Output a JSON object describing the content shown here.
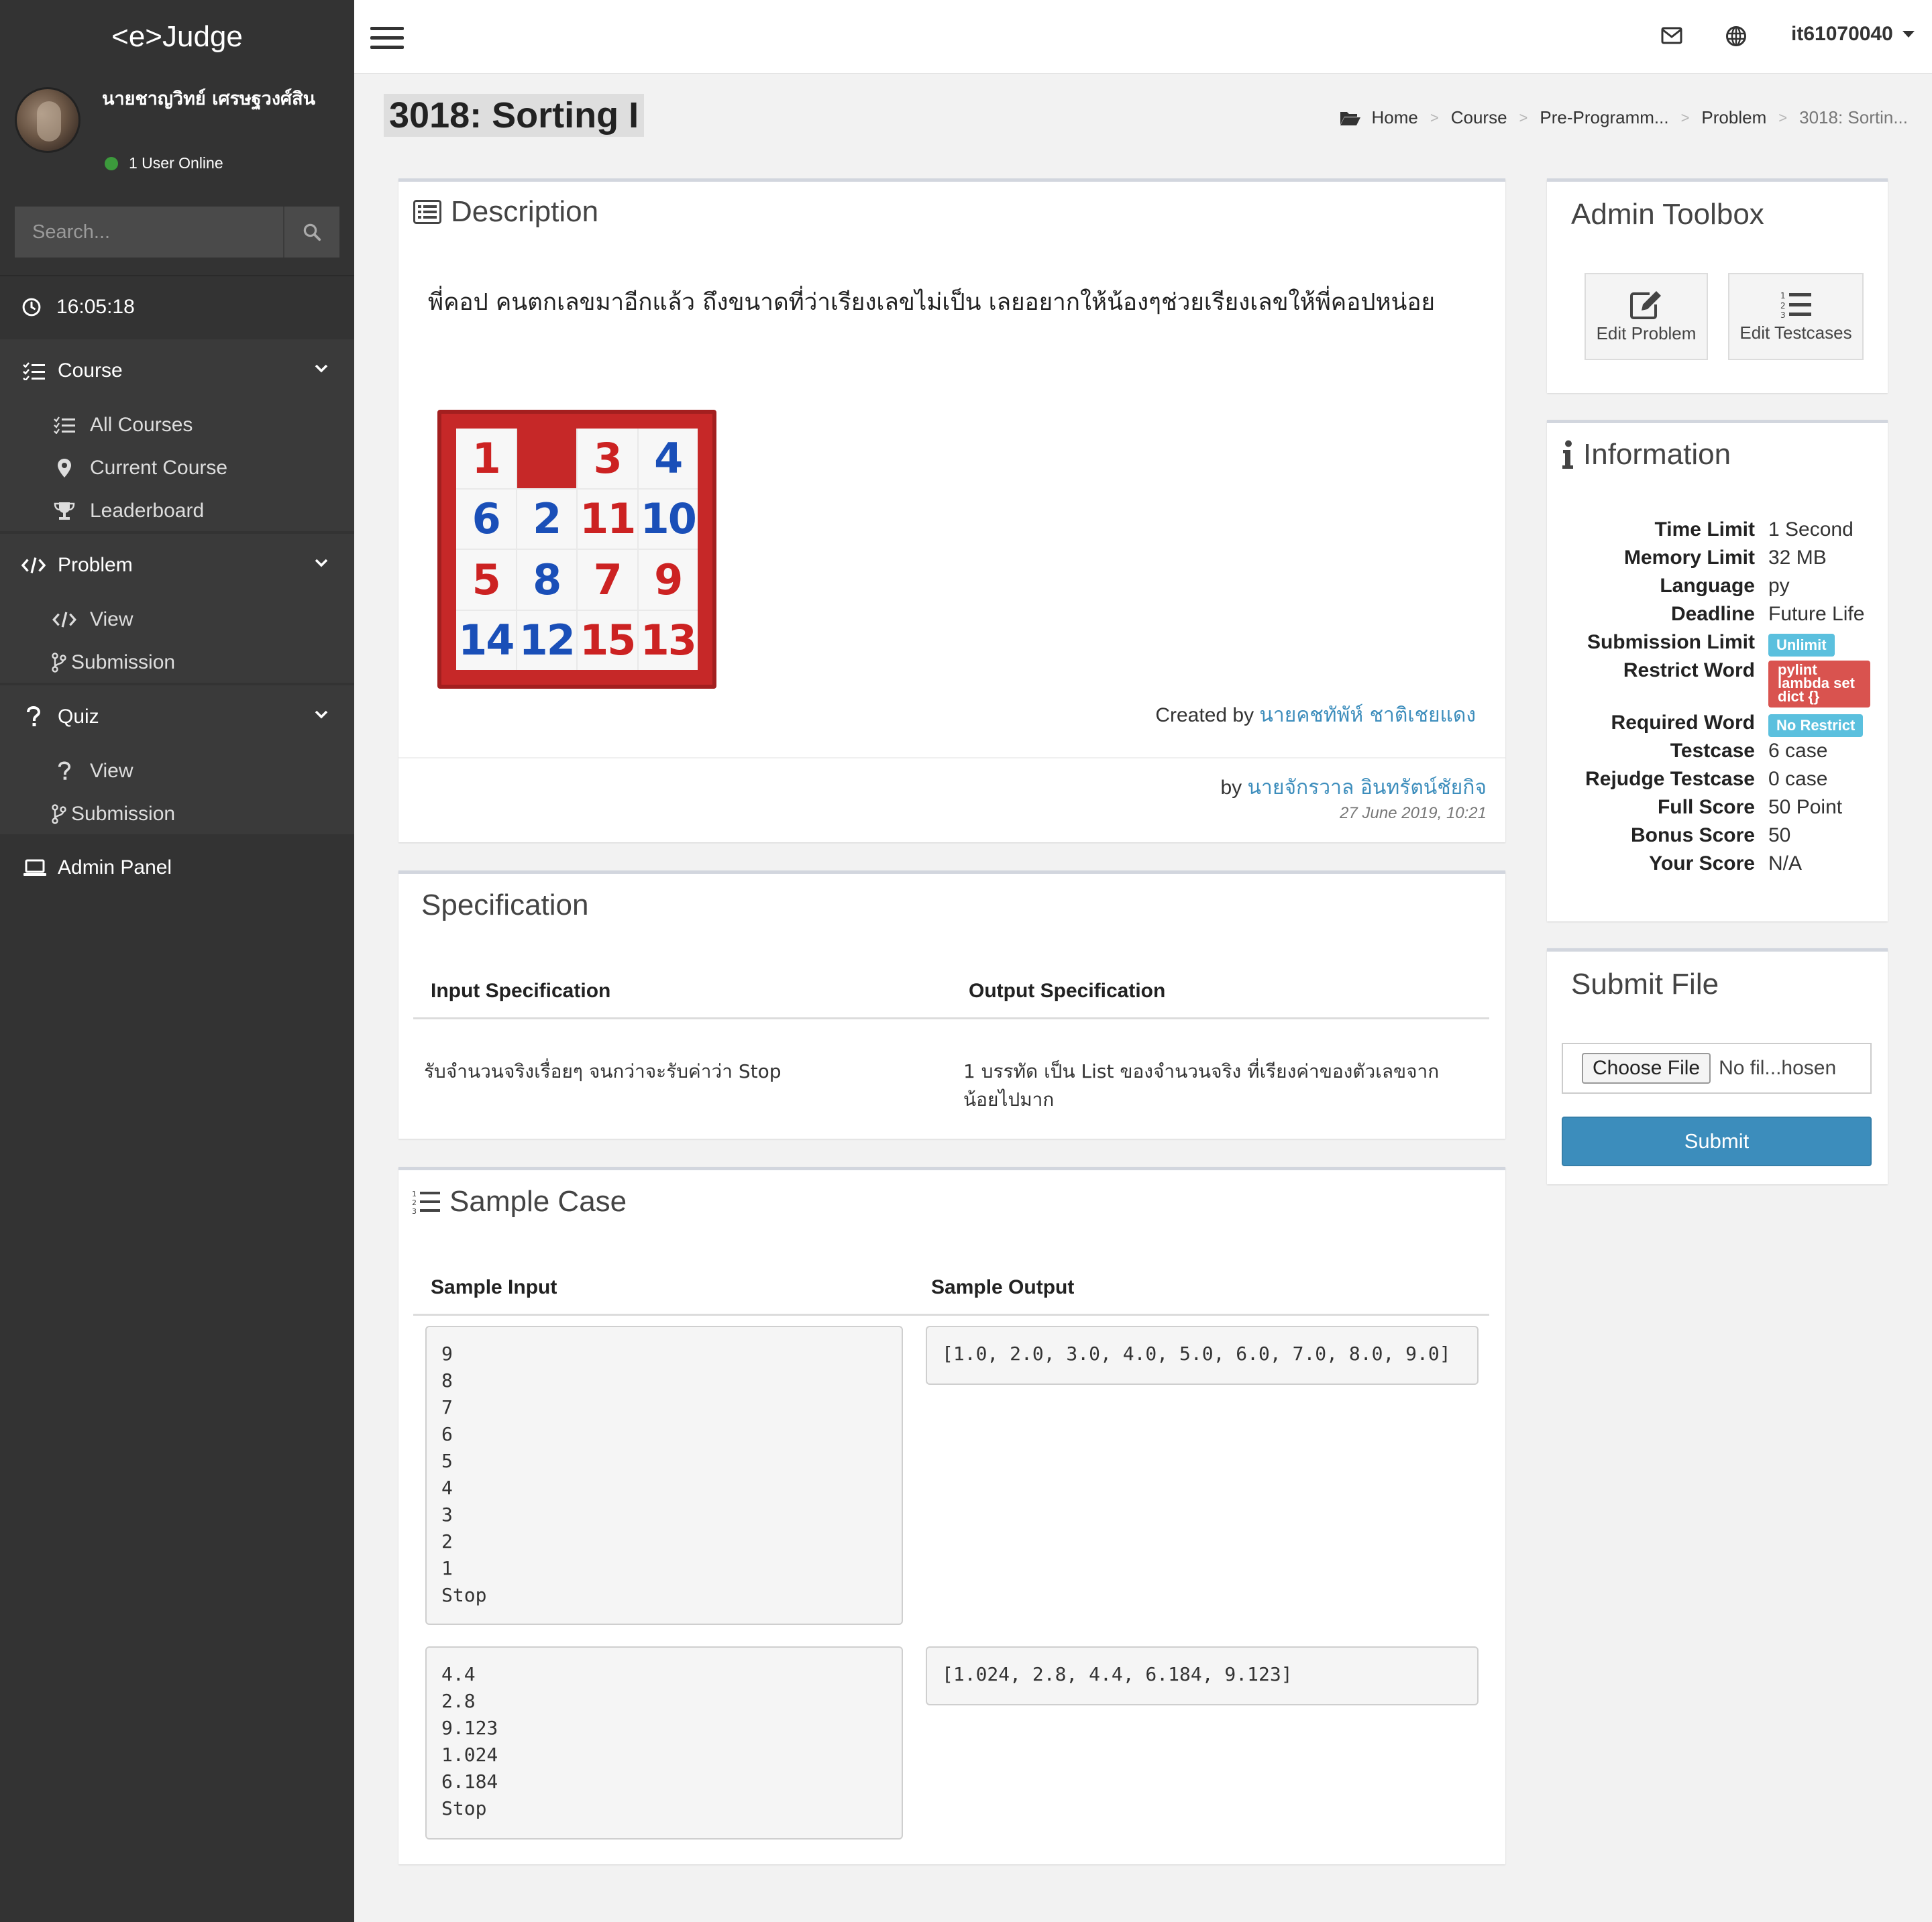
{
  "app": {
    "brand": "<e>Judge"
  },
  "user": {
    "name": "นายชาญวิทย์ เศรษฐวงศ์สิน",
    "online": "1 User Online",
    "username": "it61070040"
  },
  "search": {
    "placeholder": "Search..."
  },
  "clock": "16:05:18",
  "nav": {
    "course": {
      "label": "Course",
      "items": [
        "All Courses",
        "Current Course",
        "Leaderboard"
      ]
    },
    "problem": {
      "label": "Problem",
      "items": [
        "View",
        "Submission"
      ]
    },
    "quiz": {
      "label": "Quiz",
      "items": [
        "View",
        "Submission"
      ]
    },
    "admin": "Admin Panel"
  },
  "page": {
    "title": "3018: Sorting I"
  },
  "breadcrumb": [
    "Home",
    "Course",
    "Pre-Programm...",
    "Problem",
    "3018: Sortin..."
  ],
  "description": {
    "title": "Description",
    "text": "พี่คอป คนตกเลขมาอีกแล้ว ถึงขนาดที่ว่าเรียงเลขไม่เป็น เลยอยากให้น้องๆช่วยเรียงเลขให้พี่คอปหน่อย",
    "puzzle": [
      "1",
      "",
      "3",
      "4",
      "6",
      "2",
      "11",
      "10",
      "5",
      "8",
      "7",
      "9",
      "14",
      "12",
      "15",
      "13"
    ],
    "created_prefix": "Created by",
    "created_by": "นายคชทัพัห์ ชาติเชยแดง",
    "by_prefix": "by",
    "by_name": "นายจักรวาล อินทรัตน์ชัยกิจ",
    "date": "27 June 2019, 10:21"
  },
  "specification": {
    "title": "Specification",
    "input_header": "Input Specification",
    "output_header": "Output Specification",
    "input": "รับจำนวนจริงเรื่อยๆ จนกว่าจะรับค่าว่า Stop",
    "output": "1 บรรทัด เป็น List ของจำนวนจริง ที่เรียงค่าของตัวเลขจากน้อยไปมาก"
  },
  "sample": {
    "title": "Sample Case",
    "input_header": "Sample Input",
    "output_header": "Sample Output",
    "cases": [
      {
        "input": "9\n8\n7\n6\n5\n4\n3\n2\n1\nStop",
        "output": "[1.0, 2.0, 3.0, 4.0, 5.0, 6.0, 7.0, 8.0, 9.0]"
      },
      {
        "input": "4.4\n2.8\n9.123\n1.024\n6.184\nStop",
        "output": "[1.024, 2.8, 4.4, 6.184, 9.123]"
      }
    ]
  },
  "toolbox": {
    "title": "Admin Toolbox",
    "edit_problem": "Edit Problem",
    "edit_testcases": "Edit Testcases"
  },
  "information": {
    "title": "Information",
    "rows": [
      {
        "k": "Time Limit",
        "v": "1 Second"
      },
      {
        "k": "Memory Limit",
        "v": "32 MB"
      },
      {
        "k": "Language",
        "v": "py"
      },
      {
        "k": "Deadline",
        "v": "Future Life"
      },
      {
        "k": "Submission Limit",
        "v": "Unlimit"
      },
      {
        "k": "Restrict Word",
        "v": "pylint lambda set dict {}"
      },
      {
        "k": "Required Word",
        "v": "No Restrict"
      },
      {
        "k": "Testcase",
        "v": "6 case"
      },
      {
        "k": "Rejudge Testcase",
        "v": "0 case"
      },
      {
        "k": "Full Score",
        "v": "50 Point"
      },
      {
        "k": "Bonus Score",
        "v": "50"
      },
      {
        "k": "Your Score",
        "v": "N/A"
      }
    ],
    "restrict_lines": [
      "pylint",
      "lambda set",
      "dict {}"
    ]
  },
  "submit": {
    "title": "Submit File",
    "choose": "Choose File",
    "no_file": "No fil...hosen",
    "button": "Submit"
  },
  "colors": {
    "sidebar": "#333333",
    "accent": "#3c8dbc",
    "badge_info": "#5bc0de",
    "badge_danger": "#d9534f"
  }
}
